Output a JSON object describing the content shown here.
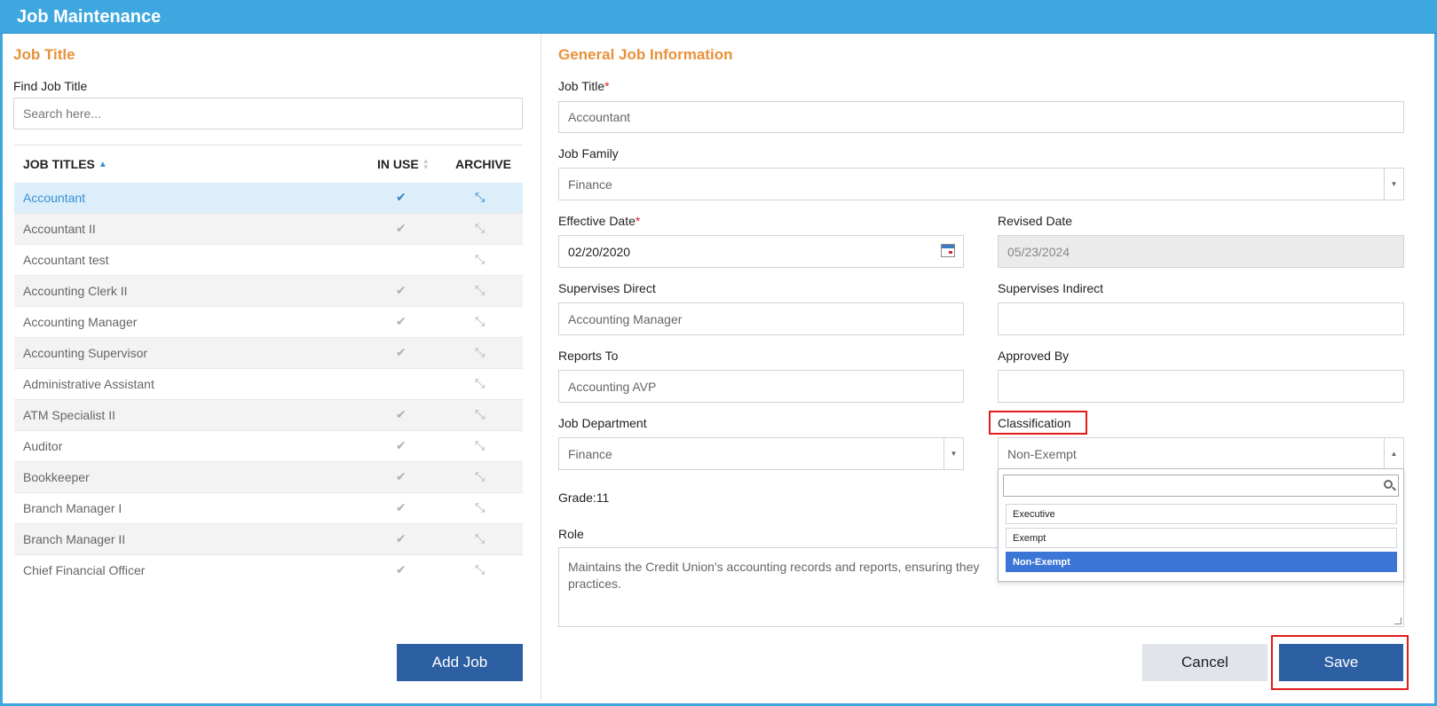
{
  "window": {
    "title": "Job Maintenance"
  },
  "left": {
    "section_title": "Job Title",
    "find_label": "Find Job Title",
    "search_placeholder": "Search here...",
    "columns": {
      "title": "JOB TITLES",
      "in_use": "IN USE",
      "archive": "ARCHIVE"
    },
    "rows": [
      {
        "name": "Accountant",
        "in_use": true,
        "selected": true
      },
      {
        "name": "Accountant II",
        "in_use": true
      },
      {
        "name": "Accountant test",
        "in_use": false
      },
      {
        "name": "Accounting Clerk II",
        "in_use": true
      },
      {
        "name": "Accounting Manager",
        "in_use": true
      },
      {
        "name": "Accounting Supervisor",
        "in_use": true
      },
      {
        "name": "Administrative Assistant",
        "in_use": false
      },
      {
        "name": "ATM Specialist II",
        "in_use": true
      },
      {
        "name": "Auditor",
        "in_use": true
      },
      {
        "name": "Bookkeeper",
        "in_use": true
      },
      {
        "name": "Branch Manager I",
        "in_use": true
      },
      {
        "name": "Branch Manager II",
        "in_use": true
      },
      {
        "name": "Chief Financial Officer",
        "in_use": true
      }
    ],
    "add_button": "Add Job"
  },
  "form": {
    "section_title": "General Job Information",
    "job_title": {
      "label": "Job Title",
      "required": "*",
      "value": "Accountant"
    },
    "job_family": {
      "label": "Job Family",
      "value": "Finance"
    },
    "effective_date": {
      "label": "Effective Date",
      "required": "*",
      "value": "02/20/2020"
    },
    "revised_date": {
      "label": "Revised Date",
      "value": "05/23/2024"
    },
    "supervises_direct": {
      "label": "Supervises Direct",
      "value": "Accounting Manager"
    },
    "supervises_indirect": {
      "label": "Supervises Indirect",
      "value": ""
    },
    "reports_to": {
      "label": "Reports To",
      "value": "Accounting AVP"
    },
    "approved_by": {
      "label": "Approved By",
      "value": ""
    },
    "job_department": {
      "label": "Job Department",
      "value": "Finance"
    },
    "classification": {
      "label": "Classification",
      "value": "Non-Exempt",
      "options": [
        "Executive",
        "Exempt",
        "Non-Exempt"
      ],
      "selected_option": "Non-Exempt"
    },
    "grade": "Grade:11",
    "role": {
      "label": "Role",
      "value_line1": "Maintains the Credit Union's accounting records and reports, ensuring they",
      "value_line2": "practices."
    },
    "cancel_button": "Cancel",
    "save_button": "Save"
  },
  "colors": {
    "title_bar": "#3ea7e0",
    "section_title": "#e8913a",
    "primary_button": "#2d5fa3",
    "highlight": "#e01b1b",
    "selected_option": "#3b76d6"
  }
}
